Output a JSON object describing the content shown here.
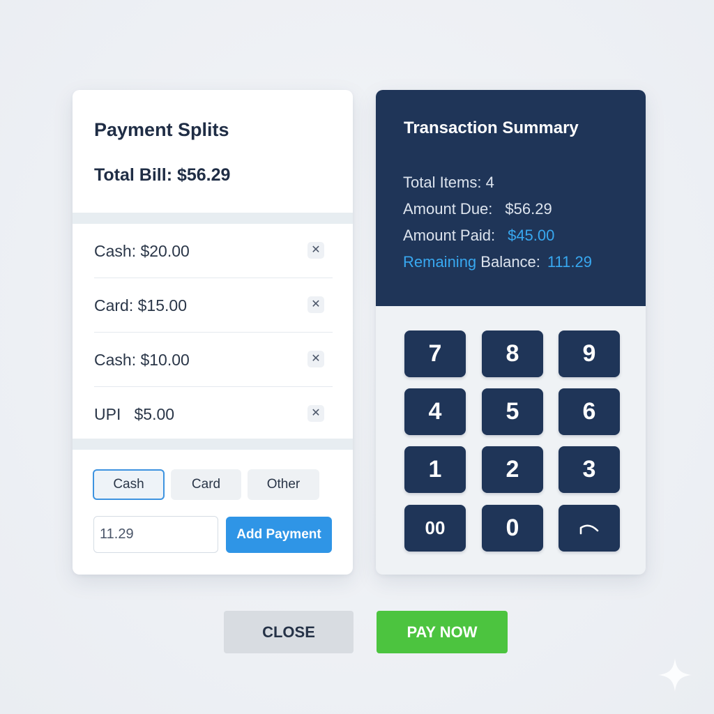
{
  "payment_splits": {
    "title": "Payment Splits",
    "total_bill": "Total Bill: $56.29",
    "splits": [
      {
        "label": "Cash: $20.00",
        "remove_icon": "close-icon"
      },
      {
        "label": "Card: $15.00",
        "remove_icon": "close-icon"
      },
      {
        "label": "Cash: $10.00",
        "remove_icon": "close-icon"
      },
      {
        "label": "UPI   $5.00",
        "remove_icon": "close-icon"
      }
    ],
    "methods": {
      "cash": "Cash",
      "card": "Card",
      "other": "Other",
      "selected": "Cash"
    },
    "amount_input_value": "11.29",
    "add_payment_label": "Add Payment"
  },
  "transaction_summary": {
    "title": "Transaction Summary",
    "total_items_label": "Total Items: 4",
    "amount_due_label": "Amount Due:",
    "amount_due_value": "$56.29",
    "amount_paid_label": "Amount Paid:",
    "amount_paid_value": "$45.00",
    "remaining_label_part1": "Remaining",
    "remaining_label_part2": " Balance:",
    "remaining_value": "111.29"
  },
  "keypad": {
    "keys": [
      "7",
      "8",
      "9",
      "4",
      "5",
      "6",
      "1",
      "2",
      "3",
      "00",
      "0"
    ],
    "backspace_icon": "backspace-icon"
  },
  "footer": {
    "close_label": "CLOSE",
    "pay_label": "PAY NOW"
  },
  "colors": {
    "navy": "#1f3558",
    "accent_blue": "#2f95e6",
    "highlight_blue": "#38a8f0",
    "pay_green": "#4cc43f",
    "close_gray": "#d8dce1"
  }
}
